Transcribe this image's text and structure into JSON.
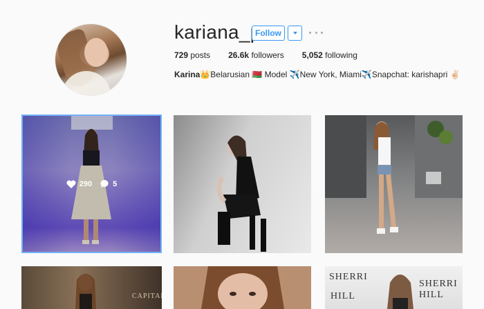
{
  "profile": {
    "username": "kariana_p",
    "follow_label": "Follow",
    "posts_count": "729",
    "posts_label": "posts",
    "followers_count": "26.6k",
    "followers_label": "followers",
    "following_count": "5,052",
    "following_label": "following",
    "bio_name": "Karina",
    "bio_text": "👑Belarusian 🇧🇾 Model ✈️New York, Miami✈️Snapchat: karishapri ✌🏻"
  },
  "icons": {
    "dropdown": "chevron-down-icon",
    "more": "more-options-icon",
    "heart": "heart-icon",
    "comment": "comment-icon"
  },
  "grid": {
    "posts": [
      {
        "id": "post-1",
        "likes": "290",
        "comments": "5",
        "hovered": true
      },
      {
        "id": "post-2"
      },
      {
        "id": "post-3"
      },
      {
        "id": "post-4",
        "overlay_text": "CAPITALE"
      },
      {
        "id": "post-5"
      },
      {
        "id": "post-6",
        "overlay_text_1": "SHERRI",
        "overlay_text_2": "SHERRI HILL",
        "overlay_text_3": "HILL"
      }
    ]
  },
  "colors": {
    "accent": "#3897f0",
    "text": "#262626",
    "background": "#fafafa"
  }
}
